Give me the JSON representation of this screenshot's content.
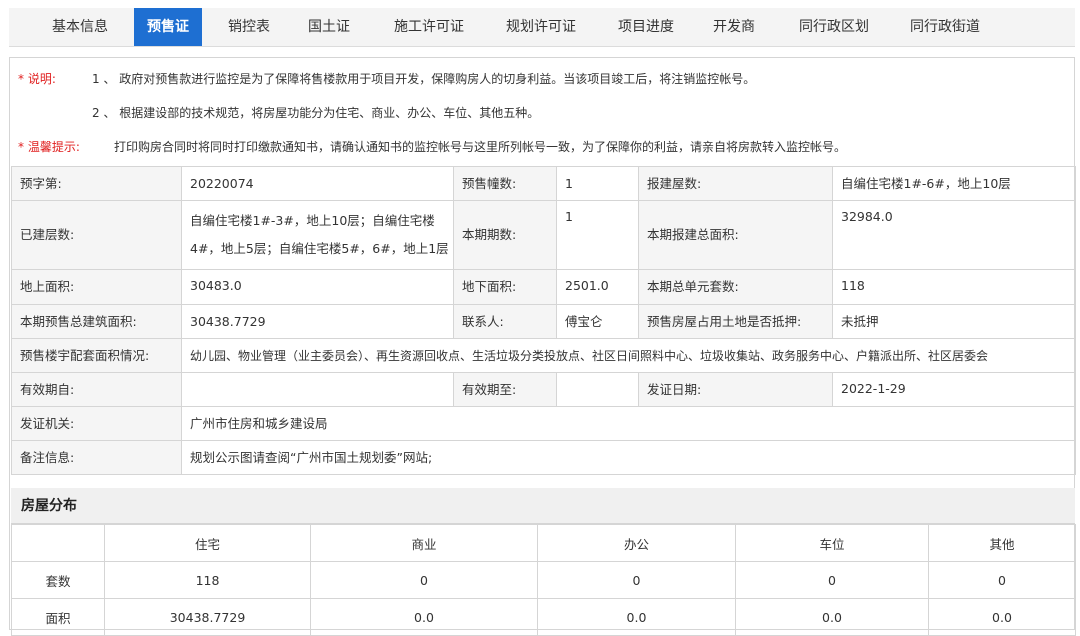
{
  "tabs": [
    "基本信息",
    "预售证",
    "销控表",
    "国土证",
    "施工许可证",
    "规划许可证",
    "项目进度",
    "开发商",
    "同行政区划",
    "同行政街道"
  ],
  "active_tab": "预售证",
  "notes": {
    "explain_label": "* 说明:",
    "explain_1": "1 、 政府对预售款进行监控是为了保障将售楼款用于项目开发，保障购房人的切身利益。当该项目竣工后，将注销监控帐号。",
    "explain_2": "2 、 根据建设部的技术规范，将房屋功能分为住宅、商业、办公、车位、其他五种。",
    "tip_label": "* 温馨提示:",
    "tip_text": "打印购房合同时将同时打印缴款通知书，请确认通知书的监控帐号与这里所列帐号一致，为了保障你的利益，请亲自将房款转入监控帐号。"
  },
  "info": {
    "presale_no_label": "预字第:",
    "presale_no": "20220074",
    "presale_buildings_label": "预售幢数:",
    "presale_buildings": "1",
    "reported_floors_label": "报建屋数:",
    "reported_floors": "自编住宅楼1#-6#，地上10层",
    "built_floors_label": "已建层数:",
    "built_floors": "自编住宅楼1#-3#，地上10层；自编住宅楼4#，地上5层；自编住宅楼5#，6#，地上1层",
    "phase_label": "本期期数:",
    "phase": "1",
    "phase_total_area_label": "本期报建总面积:",
    "phase_total_area": "32984.0",
    "above_area_label": "地上面积:",
    "above_area": "30483.0",
    "below_area_label": "地下面积:",
    "below_area": "2501.0",
    "units_label": "本期总单元套数:",
    "units": "118",
    "presale_total_area_label": "本期预售总建筑面积:",
    "presale_total_area": "30438.7729",
    "contact_label": "联系人:",
    "contact": "傅宝仑",
    "mortgage_label": "预售房屋占用土地是否抵押:",
    "mortgage": "未抵押",
    "facilities_label": "预售楼宇配套面积情况:",
    "facilities": "幼儿园、物业管理（业主委员会）、再生资源回收点、生活垃圾分类投放点、社区日间照料中心、垃圾收集站、政务服务中心、户籍派出所、社区居委会",
    "valid_from_label": "有效期自:",
    "valid_from": "",
    "valid_to_label": "有效期至:",
    "valid_to": "",
    "issue_date_label": "发证日期:",
    "issue_date": "2022-1-29",
    "authority_label": "发证机关:",
    "authority": "广州市住房和城乡建设局",
    "remarks_label": "备注信息:",
    "remarks": "规划公示图请查阅“广州市国土规划委”网站;"
  },
  "distribution": {
    "title": "房屋分布",
    "columns": [
      "住宅",
      "商业",
      "办公",
      "车位",
      "其他"
    ],
    "rows": [
      {
        "label": "套数",
        "values": [
          "118",
          "0",
          "0",
          "0",
          "0"
        ]
      },
      {
        "label": "面积",
        "values": [
          "30438.7729",
          "0.0",
          "0.0",
          "0.0",
          "0.0"
        ]
      }
    ]
  }
}
